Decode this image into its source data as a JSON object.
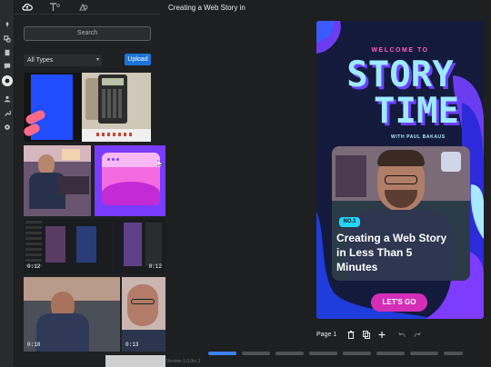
{
  "document": {
    "title": "Creating a Web Story in",
    "version": "Version 1.0.0rc.1"
  },
  "rail": {
    "icons": [
      "pin-icon",
      "shapes-icon",
      "layers-icon",
      "comment-icon",
      "media-icon",
      "user-icon",
      "wrench-icon",
      "settings-icon"
    ]
  },
  "library": {
    "tabs": [
      "media-tab",
      "text-tab",
      "shapes-tab"
    ],
    "search_placeholder": "Search",
    "filter_value": "All Types",
    "filter_chevron": "▾",
    "upload_label": "Upload",
    "items": [
      {
        "kind": "image",
        "duration": ""
      },
      {
        "kind": "image",
        "duration": ""
      },
      {
        "kind": "image",
        "duration": ""
      },
      {
        "kind": "image",
        "duration": ""
      },
      {
        "kind": "video",
        "duration": "0:12"
      },
      {
        "kind": "video",
        "duration": "0:12"
      },
      {
        "kind": "video",
        "duration": "0:18"
      },
      {
        "kind": "video",
        "duration": "0:13"
      }
    ]
  },
  "story": {
    "welcome": "WELCOME TO",
    "title_line1": "STORY",
    "title_line2": "TIME",
    "byline": "WITH PAUL BAKAUS",
    "badge": "NO.1",
    "headline": "Creating a Web Story in Less Than 5 Minutes",
    "cta": "LET'S GO"
  },
  "page_toolbar": {
    "page_label": "Page 1",
    "actions": [
      "delete-page-icon",
      "duplicate-page-icon",
      "add-page-icon",
      "undo-icon",
      "redo-icon"
    ]
  },
  "carousel": {
    "pages": 8,
    "active_index": 0
  },
  "colors": {
    "accent": "#1c74d8",
    "story_bg": "#141a3c",
    "pink": "#ff5ec1",
    "cyan": "#9ee9ff",
    "cta": "#d42eb8"
  }
}
